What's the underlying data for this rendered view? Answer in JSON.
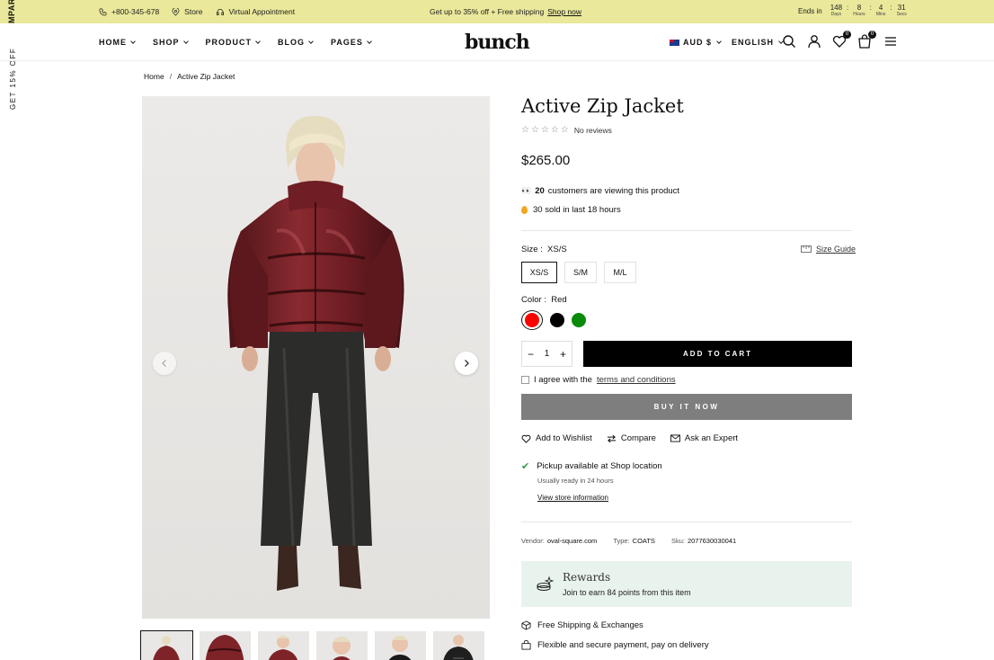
{
  "announcement": {
    "phone": "+800-345-678",
    "store": "Store",
    "virtual": "Virtual Appointment",
    "promo_text": "Get up to 35% off + Free shipping",
    "promo_link": "Shop now",
    "ends_in": "Ends in",
    "countdown": [
      {
        "value": "148",
        "label": "Days"
      },
      {
        "value": "8",
        "label": "Hours"
      },
      {
        "value": "4",
        "label": "Mins"
      },
      {
        "value": "31",
        "label": "Secs"
      }
    ]
  },
  "side_tab": {
    "compare": "MPARE",
    "offer": "GET 15% OFF"
  },
  "header": {
    "nav": [
      "HOME",
      "SHOP",
      "PRODUCT",
      "BLOG",
      "PAGES"
    ],
    "logo": "bunch",
    "currency": "AUD $",
    "language": "ENGLISH",
    "wishlist_count": "0",
    "cart_count": "0"
  },
  "breadcrumb": {
    "home": "Home",
    "sep": "/",
    "current": "Active Zip Jacket"
  },
  "product": {
    "title": "Active Zip Jacket",
    "reviews": "No reviews",
    "price": "$265.00",
    "viewing_count": "20",
    "viewing_text": "customers are viewing this product",
    "sold_text": "30 sold in last 18 hours",
    "size_label": "Size :",
    "size_value": "XS/S",
    "size_guide": "Size Guide",
    "sizes": [
      "XS/S",
      "S/M",
      "M/L"
    ],
    "color_label": "Color :",
    "color_value": "Red",
    "colors": [
      "#ff0000",
      "#000000",
      "#0a8a0a"
    ],
    "quantity": "1",
    "add_to_cart": "ADD TO CART",
    "agree_text": "I agree with the",
    "terms_link": "terms and conditions",
    "buy_now": "BUY IT NOW",
    "wishlist": "Add to Wishlist",
    "compare": "Compare",
    "ask": "Ask an Expert",
    "pickup_text": "Pickup available at Shop location",
    "pickup_ready": "Usually ready in 24 hours",
    "store_info": "View store information",
    "vendor_label": "Vendor:",
    "vendor": "oval-square.com",
    "type_label": "Type:",
    "type": "COATS",
    "sku_label": "Sku:",
    "sku": "2077630030041",
    "rewards_title": "Rewards",
    "rewards_sub": "Join to earn 84 points from this item",
    "shipping": "Free Shipping & Exchanges",
    "payment": "Flexible and secure payment, pay on delivery"
  }
}
